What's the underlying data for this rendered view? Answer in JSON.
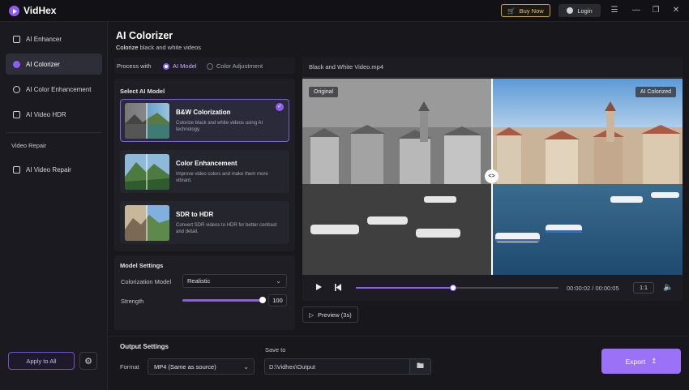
{
  "app": {
    "name": "VidHex"
  },
  "topbar": {
    "buy_label": "Buy Now",
    "login_label": "Login"
  },
  "sidebar": {
    "items": [
      {
        "label": "AI Enhancer"
      },
      {
        "label": "AI Colorizer"
      },
      {
        "label": "AI Color Enhancement"
      },
      {
        "label": "AI Video HDR"
      }
    ],
    "section_repair": "Video Repair",
    "repair_items": [
      {
        "label": "AI Video Repair"
      }
    ],
    "apply_all_label": "Apply to All"
  },
  "main": {
    "title": "AI Colorizer",
    "subtitle_strong": "Colorize",
    "subtitle_rest": " black and white videos",
    "process_with_label": "Process with",
    "process_options": [
      "AI Model",
      "Color Adjustment"
    ],
    "process_selected": "AI Model",
    "select_model_title": "Select AI Model",
    "models": [
      {
        "title": "B&W Colorization",
        "desc": "Colorize black and white videos using AI technology.",
        "selected": true
      },
      {
        "title": "Color Enhancement",
        "desc": "Improve video colors and make them more vibrant.",
        "selected": false
      },
      {
        "title": "SDR to HDR",
        "desc": "Convert SDR videos to HDR for better contrast and detail.",
        "selected": false
      }
    ],
    "model_settings_title": "Model Settings",
    "colorization_model_label": "Colorization Model",
    "colorization_model_value": "Realistic",
    "strength_label": "Strength",
    "strength_value": "100"
  },
  "video": {
    "filename": "Black and White Video.mp4",
    "original_tag": "Original",
    "colorized_tag": "AI Colorized",
    "time_current": "00:00:02",
    "time_total": "00:00:05",
    "time_text": "00:00:02 / 00:00:05",
    "progress": 0.48,
    "ratio": "1:1",
    "preview_label": "Preview (3s)"
  },
  "output": {
    "title": "Output Settings",
    "format_label": "Format",
    "format_value": "MP4 (Same as source)",
    "save_to_label": "Save to",
    "save_path": "D:\\Vidhex\\Output",
    "export_label": "Export"
  },
  "colors": {
    "accent": "#8c5cf5",
    "export": "#9b72f7",
    "buy_gold": "#c8a24a"
  }
}
